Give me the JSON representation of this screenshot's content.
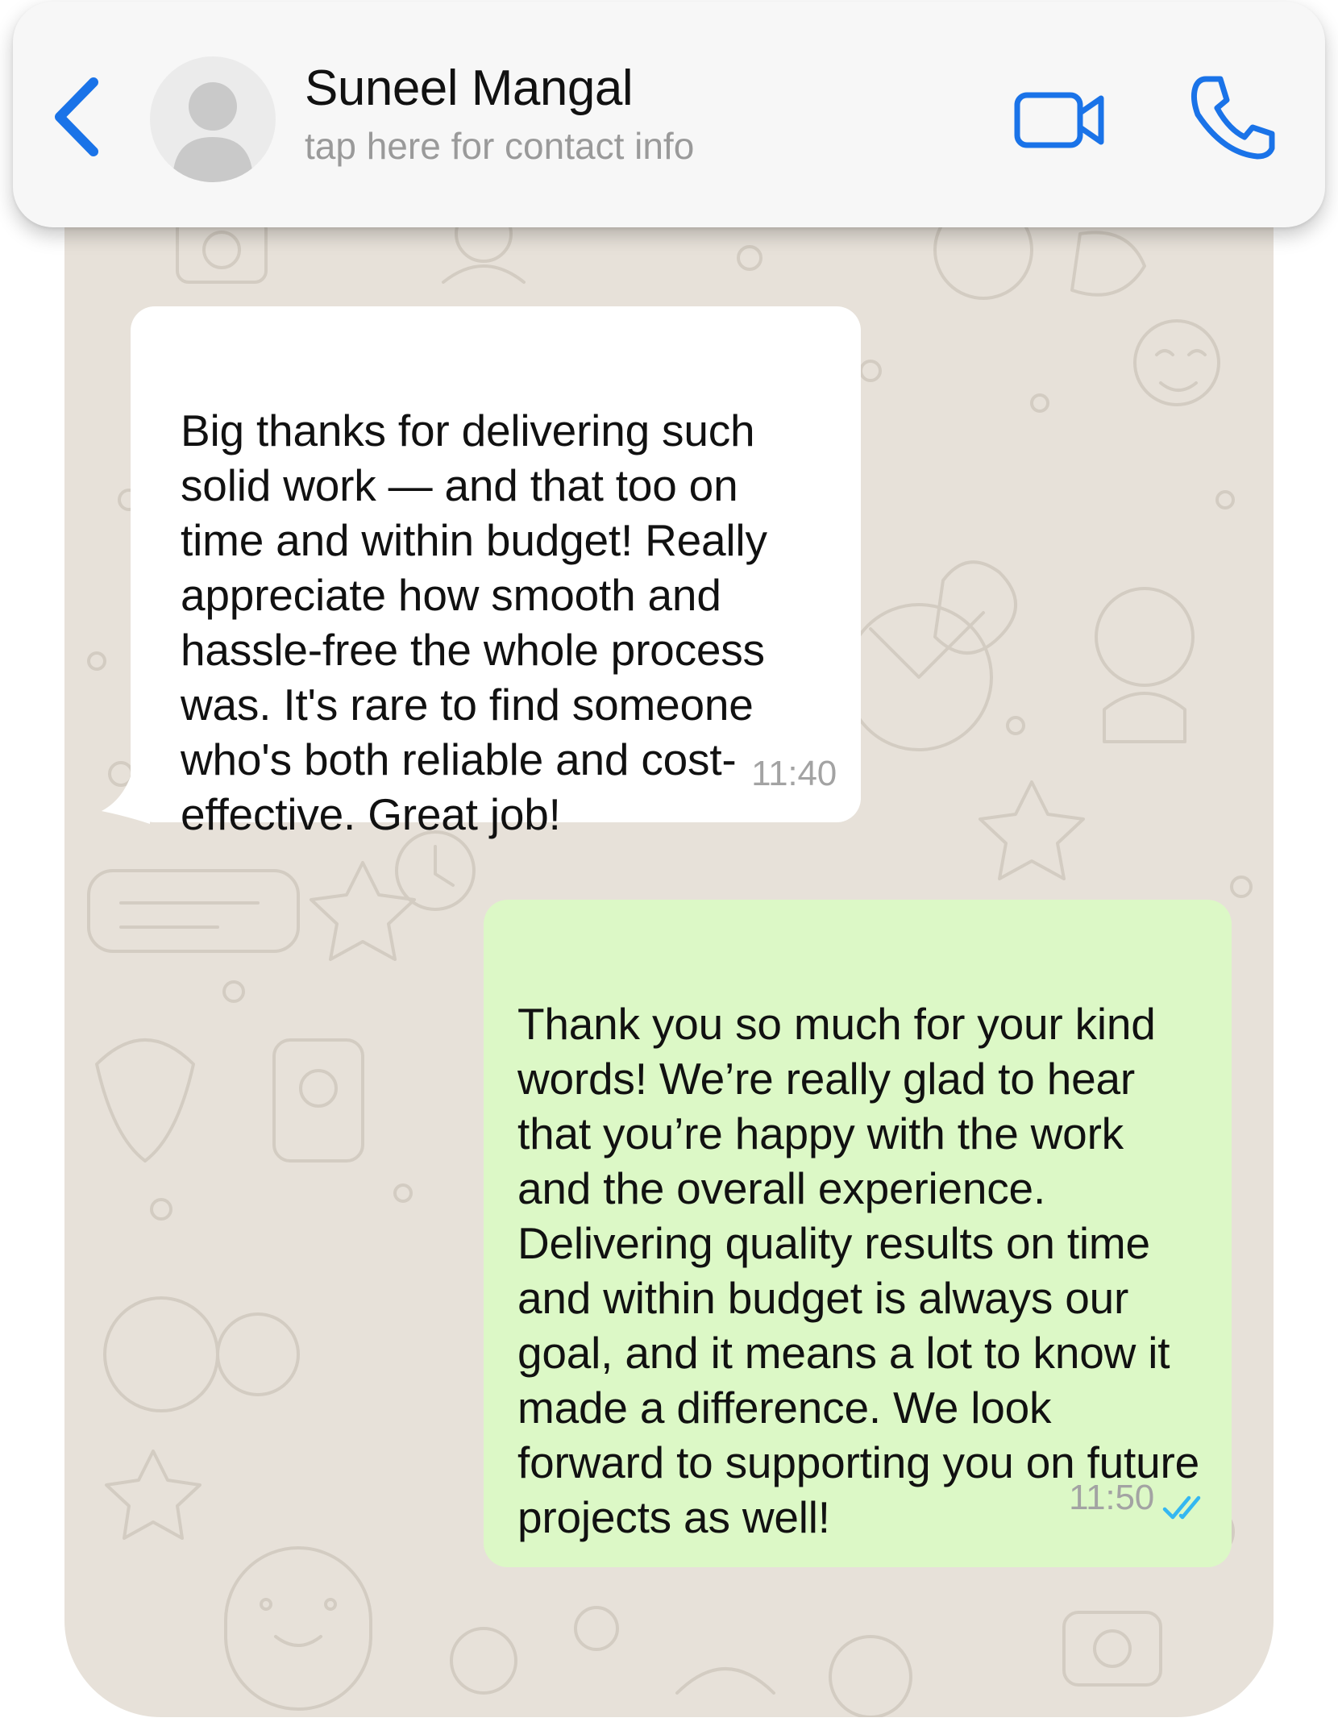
{
  "header": {
    "contact_name": "Suneel Mangal",
    "contact_subtitle": "tap here for contact info",
    "icons": [
      "chevron-left-icon",
      "avatar-placeholder-icon",
      "video-camera-icon",
      "phone-icon"
    ],
    "accent_color": "#1a73e8"
  },
  "messages": [
    {
      "direction": "incoming",
      "text": "Big thanks for delivering such solid work — and that too on time and within budget! Really appreciate how smooth and hassle-free the whole process was. It's rare to find someone who's both reliable and cost-effective. Great job!",
      "time": "11:40",
      "bubble_color": "#ffffff"
    },
    {
      "direction": "outgoing",
      "text": "Thank you so much for your kind words! We’re really glad to hear that you’re happy with the work and the overall experience. Delivering quality results on time and within budget is always our goal, and it means a lot to know it made a difference. We look forward to supporting you on future projects as well!",
      "time": "11:50",
      "status_icon": "double-check-read-icon",
      "bubble_color": "#dcf8c6"
    }
  ],
  "colors": {
    "chat_background": "#e7e1d9",
    "header_background": "#f7f7f7",
    "read_tick": "#34b7f1"
  }
}
